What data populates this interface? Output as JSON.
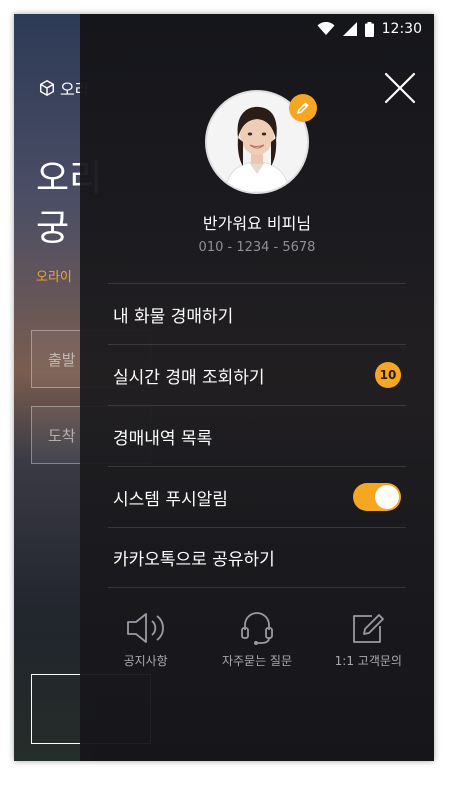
{
  "status_bar": {
    "time": "12:30"
  },
  "background": {
    "logo_text": "오라",
    "title_line1": "오리",
    "title_line2": "궁",
    "subtitle": "오라이",
    "field1": "출발",
    "field2": "도착"
  },
  "profile": {
    "name": "반가워요 비피님",
    "phone": "010 - 1234 - 5678"
  },
  "menu": [
    {
      "label": "내 화물 경매하기"
    },
    {
      "label": "실시간 경매 조회하기",
      "badge": "10"
    },
    {
      "label": "경매내역 목록"
    },
    {
      "label": "시스템 푸시알림",
      "toggle_on": true
    },
    {
      "label": "카카오톡으로 공유하기"
    }
  ],
  "footer": [
    {
      "label": "공지사항",
      "icon": "speaker-icon"
    },
    {
      "label": "자주묻는 질문",
      "icon": "headset-icon"
    },
    {
      "label": "1:1 고객문의",
      "icon": "edit-note-icon"
    }
  ],
  "colors": {
    "accent": "#f5a623",
    "drawer_bg": "#1c1c20"
  }
}
